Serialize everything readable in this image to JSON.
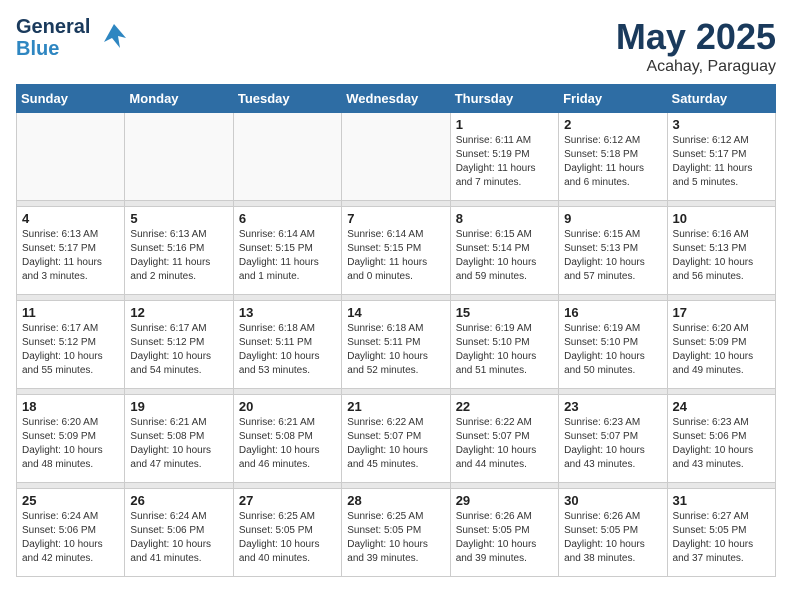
{
  "header": {
    "logo_line1": "General",
    "logo_line2": "Blue",
    "month_year": "May 2025",
    "location": "Acahay, Paraguay"
  },
  "weekdays": [
    "Sunday",
    "Monday",
    "Tuesday",
    "Wednesday",
    "Thursday",
    "Friday",
    "Saturday"
  ],
  "weeks": [
    [
      {
        "day": "",
        "info": ""
      },
      {
        "day": "",
        "info": ""
      },
      {
        "day": "",
        "info": ""
      },
      {
        "day": "",
        "info": ""
      },
      {
        "day": "1",
        "info": "Sunrise: 6:11 AM\nSunset: 5:19 PM\nDaylight: 11 hours\nand 7 minutes."
      },
      {
        "day": "2",
        "info": "Sunrise: 6:12 AM\nSunset: 5:18 PM\nDaylight: 11 hours\nand 6 minutes."
      },
      {
        "day": "3",
        "info": "Sunrise: 6:12 AM\nSunset: 5:17 PM\nDaylight: 11 hours\nand 5 minutes."
      }
    ],
    [
      {
        "day": "4",
        "info": "Sunrise: 6:13 AM\nSunset: 5:17 PM\nDaylight: 11 hours\nand 3 minutes."
      },
      {
        "day": "5",
        "info": "Sunrise: 6:13 AM\nSunset: 5:16 PM\nDaylight: 11 hours\nand 2 minutes."
      },
      {
        "day": "6",
        "info": "Sunrise: 6:14 AM\nSunset: 5:15 PM\nDaylight: 11 hours\nand 1 minute."
      },
      {
        "day": "7",
        "info": "Sunrise: 6:14 AM\nSunset: 5:15 PM\nDaylight: 11 hours\nand 0 minutes."
      },
      {
        "day": "8",
        "info": "Sunrise: 6:15 AM\nSunset: 5:14 PM\nDaylight: 10 hours\nand 59 minutes."
      },
      {
        "day": "9",
        "info": "Sunrise: 6:15 AM\nSunset: 5:13 PM\nDaylight: 10 hours\nand 57 minutes."
      },
      {
        "day": "10",
        "info": "Sunrise: 6:16 AM\nSunset: 5:13 PM\nDaylight: 10 hours\nand 56 minutes."
      }
    ],
    [
      {
        "day": "11",
        "info": "Sunrise: 6:17 AM\nSunset: 5:12 PM\nDaylight: 10 hours\nand 55 minutes."
      },
      {
        "day": "12",
        "info": "Sunrise: 6:17 AM\nSunset: 5:12 PM\nDaylight: 10 hours\nand 54 minutes."
      },
      {
        "day": "13",
        "info": "Sunrise: 6:18 AM\nSunset: 5:11 PM\nDaylight: 10 hours\nand 53 minutes."
      },
      {
        "day": "14",
        "info": "Sunrise: 6:18 AM\nSunset: 5:11 PM\nDaylight: 10 hours\nand 52 minutes."
      },
      {
        "day": "15",
        "info": "Sunrise: 6:19 AM\nSunset: 5:10 PM\nDaylight: 10 hours\nand 51 minutes."
      },
      {
        "day": "16",
        "info": "Sunrise: 6:19 AM\nSunset: 5:10 PM\nDaylight: 10 hours\nand 50 minutes."
      },
      {
        "day": "17",
        "info": "Sunrise: 6:20 AM\nSunset: 5:09 PM\nDaylight: 10 hours\nand 49 minutes."
      }
    ],
    [
      {
        "day": "18",
        "info": "Sunrise: 6:20 AM\nSunset: 5:09 PM\nDaylight: 10 hours\nand 48 minutes."
      },
      {
        "day": "19",
        "info": "Sunrise: 6:21 AM\nSunset: 5:08 PM\nDaylight: 10 hours\nand 47 minutes."
      },
      {
        "day": "20",
        "info": "Sunrise: 6:21 AM\nSunset: 5:08 PM\nDaylight: 10 hours\nand 46 minutes."
      },
      {
        "day": "21",
        "info": "Sunrise: 6:22 AM\nSunset: 5:07 PM\nDaylight: 10 hours\nand 45 minutes."
      },
      {
        "day": "22",
        "info": "Sunrise: 6:22 AM\nSunset: 5:07 PM\nDaylight: 10 hours\nand 44 minutes."
      },
      {
        "day": "23",
        "info": "Sunrise: 6:23 AM\nSunset: 5:07 PM\nDaylight: 10 hours\nand 43 minutes."
      },
      {
        "day": "24",
        "info": "Sunrise: 6:23 AM\nSunset: 5:06 PM\nDaylight: 10 hours\nand 43 minutes."
      }
    ],
    [
      {
        "day": "25",
        "info": "Sunrise: 6:24 AM\nSunset: 5:06 PM\nDaylight: 10 hours\nand 42 minutes."
      },
      {
        "day": "26",
        "info": "Sunrise: 6:24 AM\nSunset: 5:06 PM\nDaylight: 10 hours\nand 41 minutes."
      },
      {
        "day": "27",
        "info": "Sunrise: 6:25 AM\nSunset: 5:05 PM\nDaylight: 10 hours\nand 40 minutes."
      },
      {
        "day": "28",
        "info": "Sunrise: 6:25 AM\nSunset: 5:05 PM\nDaylight: 10 hours\nand 39 minutes."
      },
      {
        "day": "29",
        "info": "Sunrise: 6:26 AM\nSunset: 5:05 PM\nDaylight: 10 hours\nand 39 minutes."
      },
      {
        "day": "30",
        "info": "Sunrise: 6:26 AM\nSunset: 5:05 PM\nDaylight: 10 hours\nand 38 minutes."
      },
      {
        "day": "31",
        "info": "Sunrise: 6:27 AM\nSunset: 5:05 PM\nDaylight: 10 hours\nand 37 minutes."
      }
    ]
  ]
}
